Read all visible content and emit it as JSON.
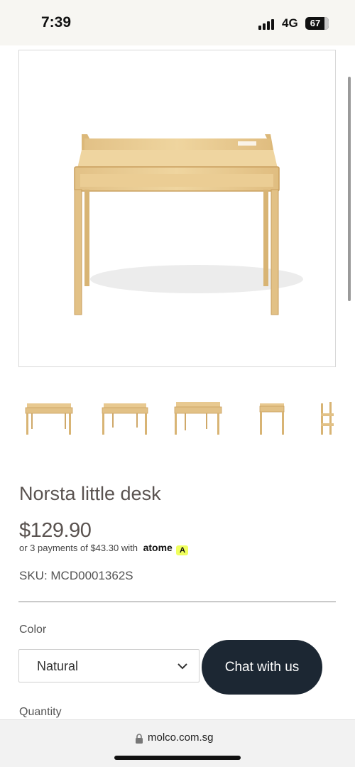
{
  "status": {
    "time": "7:39",
    "network": "4G",
    "battery": "67"
  },
  "product": {
    "image_alt": "Norsta little desk photo",
    "title": "Norsta little desk",
    "price": "$129.90",
    "installment_text": "or 3 payments of $43.30 with",
    "installment_provider": "atome",
    "sku": "SKU: MCD0001362S"
  },
  "thumbnails": [
    {
      "name": "thumb-desk-front"
    },
    {
      "name": "thumb-desk-angle"
    },
    {
      "name": "thumb-desk-side-angle"
    },
    {
      "name": "thumb-desk-side"
    },
    {
      "name": "thumb-desk-with-chair"
    }
  ],
  "options": {
    "color_label": "Color",
    "color_value": "Natural",
    "quantity_label": "Quantity"
  },
  "chat": {
    "label": "Chat with us"
  },
  "browser": {
    "url": "molco.com.sg"
  },
  "colors": {
    "wood": "#e8c990",
    "wood_dark": "#cfa869",
    "chat_bg": "#1c2733"
  }
}
